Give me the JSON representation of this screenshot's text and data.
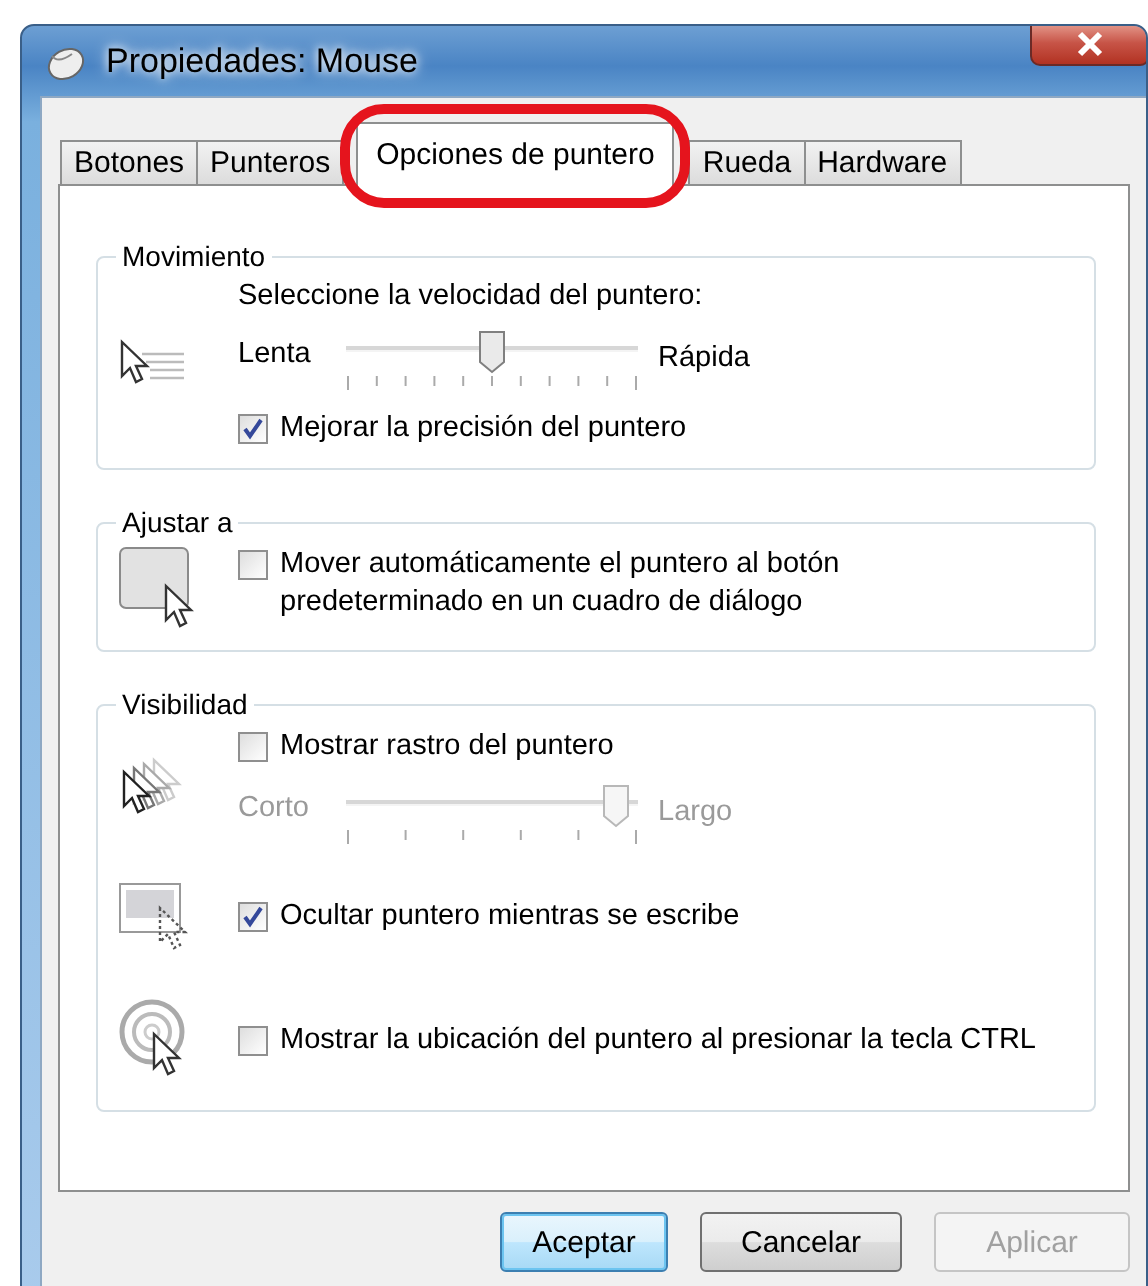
{
  "window": {
    "title": "Propiedades: Mouse"
  },
  "tabs": [
    {
      "label": "Botones",
      "selected": false
    },
    {
      "label": "Punteros",
      "selected": false
    },
    {
      "label": "Opciones de puntero",
      "selected": true
    },
    {
      "label": "Rueda",
      "selected": false
    },
    {
      "label": "Hardware",
      "selected": false
    }
  ],
  "movement": {
    "title": "Movimiento",
    "prompt": "Seleccione la velocidad del puntero:",
    "speed": {
      "min_label": "Lenta",
      "max_label": "Rápida",
      "level": 0.5,
      "disabled": false
    },
    "precision": {
      "label": "Mejorar la precisión del puntero",
      "checked": true
    }
  },
  "snap": {
    "title": "Ajustar a",
    "snap_to_default": {
      "label": "Mover automáticamente el puntero al botón\npredeterminado en un cuadro de diálogo",
      "checked": false
    }
  },
  "visibility": {
    "title": "Visibilidad",
    "trails": {
      "label": "Mostrar rastro del puntero",
      "checked": false
    },
    "trail_length": {
      "min_label": "Corto",
      "max_label": "Largo",
      "level": 0.97,
      "disabled": true
    },
    "hide_while_typing": {
      "label": "Ocultar puntero mientras se escribe",
      "checked": true
    },
    "show_location": {
      "label": "Mostrar la ubicación del puntero al presionar la tecla CTRL",
      "checked": false
    }
  },
  "buttons": [
    {
      "label": "Aceptar",
      "default": true,
      "disabled": false
    },
    {
      "label": "Cancelar",
      "default": false,
      "disabled": false
    },
    {
      "label": "Aplicar",
      "default": false,
      "disabled": true
    }
  ]
}
